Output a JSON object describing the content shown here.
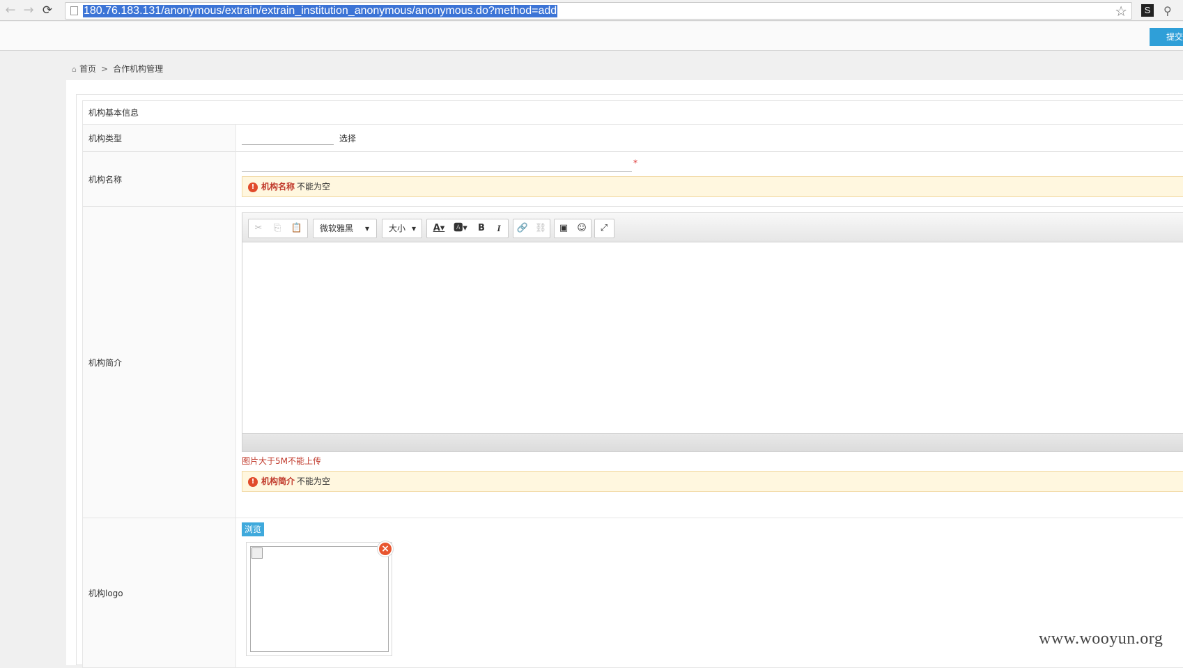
{
  "browser": {
    "url": "180.76.183.131/anonymous/extrain/extrain_institution_anonymous/anonymous.do?method=add",
    "back": "←",
    "forward": "→",
    "reload": "⟳",
    "star": "☆",
    "ext_s": "S",
    "ext_k": "⚲"
  },
  "topbar": {
    "submit_label": "提交"
  },
  "breadcrumb": {
    "home": "首页",
    "separator": ">",
    "current": "合作机构管理"
  },
  "form": {
    "section_title": "机构基本信息",
    "type": {
      "label": "机构类型",
      "select_link": "选择"
    },
    "name": {
      "label": "机构名称",
      "required_mark": "*",
      "error_field": "机构名称",
      "error_msg": "不能为空"
    },
    "intro": {
      "label": "机构简介",
      "font_select": "微软雅黑",
      "size_select": "大小",
      "note": "图片大于5M不能上传",
      "error_field": "机构简介",
      "error_msg": "不能为空"
    },
    "logo": {
      "label": "机构logo",
      "browse_label": "浏览"
    }
  },
  "toolbar_icons": [
    "cut-icon",
    "copy-icon",
    "paste-icon",
    "font-color-icon",
    "highlight-icon",
    "bold-icon",
    "italic-icon",
    "link-icon",
    "unlink-icon",
    "image-icon",
    "emoticon-icon",
    "fullscreen-icon"
  ],
  "watermark": "www.wooyun.org",
  "colors": {
    "accent": "#2f9fd8",
    "error": "#c0392b",
    "alert_bg": "#fff7df",
    "url_highlight": "#3c74d6"
  }
}
